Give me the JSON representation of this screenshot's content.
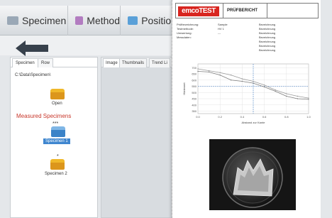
{
  "app": {
    "tabs": [
      {
        "label": "Specimen",
        "icon": "specimen-icon",
        "color": "#9aa8b6"
      },
      {
        "label": "Method",
        "icon": "method-icon",
        "color": "#b27cc0"
      },
      {
        "label": "Position",
        "icon": "position-icon",
        "color": "#5aa0d8"
      }
    ],
    "left_tabs": [
      "Specimen",
      "Row"
    ],
    "path": "C:\\Data\\Specimen\\",
    "open_label": "Open",
    "measured_title": "Measured Specimens",
    "specimens": [
      {
        "stars": "***",
        "label": "Specimen 1",
        "selected": true
      },
      {
        "stars": "*",
        "label": "Specimen 2",
        "selected": false
      }
    ],
    "right_tabs": [
      "Image",
      "Thumbnails",
      "Trend Li"
    ]
  },
  "report": {
    "logo": "emcoTEST",
    "title": "PRÜFBERICHT",
    "info": [
      {
        "label": "Prüfbezeichnung:",
        "value": "Sample",
        "right": "Bezeichnung"
      },
      {
        "label": "Testmethode:",
        "value": "HV 1",
        "right": "Bezeichnung"
      },
      {
        "label": "Umwertung:",
        "value": "---",
        "right": "Bezeichnung"
      },
      {
        "label": "Messdaten:",
        "value": "",
        "right": "Bezeichnung"
      },
      {
        "label": "",
        "value": "",
        "right": "Bezeichnung"
      },
      {
        "label": "",
        "value": "",
        "right": "Bezeichnung"
      },
      {
        "label": "",
        "value": "",
        "right": "Bezeichnung"
      }
    ]
  },
  "chart_data": {
    "type": "line",
    "xlabel": "Abstand zur Kante",
    "ylabel": "Härtewert",
    "x": [
      0.0,
      0.1,
      0.2,
      0.3,
      0.4,
      0.5,
      0.6,
      0.7,
      0.8,
      0.9,
      1.0
    ],
    "xticks": [
      "0.0",
      "0.2",
      "0.4",
      "0.6",
      "0.8",
      "1.0"
    ],
    "yticks": [
      "700",
      "650",
      "600",
      "550",
      "500",
      "450",
      "400",
      "350"
    ],
    "ylim": [
      330,
      730
    ],
    "series": [
      {
        "color": "#9a9a9a",
        "values": [
          690,
          675,
          660,
          640,
          610,
          590,
          560,
          520,
          490,
          470,
          455
        ]
      },
      {
        "color": "#7d7d7d",
        "values": [
          670,
          665,
          640,
          600,
          590,
          575,
          545,
          510,
          470,
          450,
          445
        ]
      }
    ],
    "limit_x": 0.5,
    "limit_y": 550,
    "limit_color": "#4a82c6"
  }
}
